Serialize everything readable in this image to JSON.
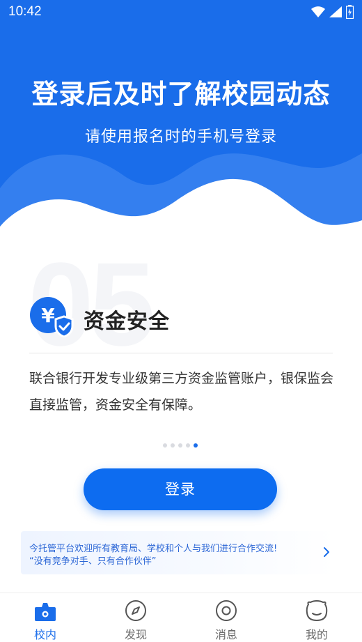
{
  "status_bar": {
    "time": "10:42"
  },
  "hero": {
    "title": "登录后及时了解校园动态",
    "subtitle": "请使用报名时的手机号登录"
  },
  "feature": {
    "index": "05",
    "title": "资金安全",
    "description": "联合银行开发专业级第三方资金监管账户，银保监会直接监管，资金安全有保障。",
    "icon": "yen-shield-icon"
  },
  "pager": {
    "total": 5,
    "active": 5
  },
  "login_button": {
    "label": "登录"
  },
  "notice": {
    "line1": "今托管平台欢迎所有教育局、学校和个人与我们进行合作交流!",
    "line2": "“没有竞争对手、只有合作伙伴”"
  },
  "tabs": [
    {
      "label": "校内",
      "icon": "school-icon",
      "active": true
    },
    {
      "label": "发现",
      "icon": "compass-icon",
      "active": false
    },
    {
      "label": "消息",
      "icon": "message-icon",
      "active": false
    },
    {
      "label": "我的",
      "icon": "profile-face-icon",
      "active": false
    }
  ],
  "colors": {
    "primary": "#1a6dea",
    "button": "#0d6cf0",
    "inactive": "#6b6b6b"
  }
}
